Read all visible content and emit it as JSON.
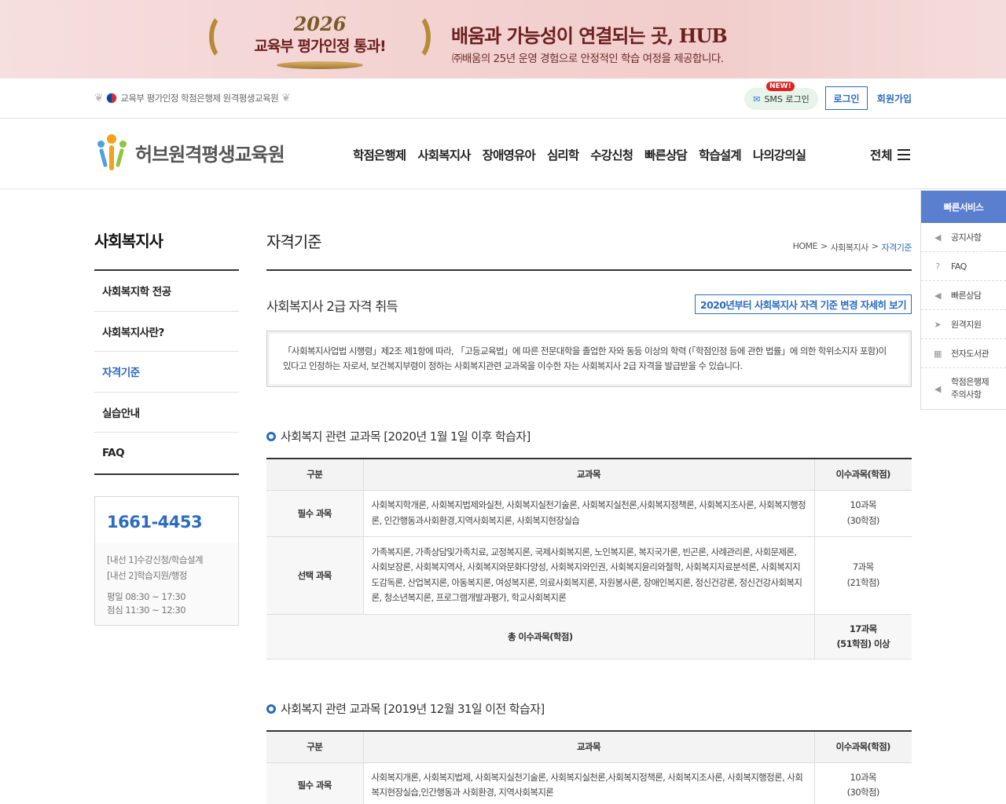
{
  "banner": {
    "year": "2026",
    "badge_text": "교육부 평가인정 통과!",
    "tagline": "배움과 가능성이 연결되는 곳, HUB",
    "subtitle": "㈜배움의 25년 운영 경험으로 안정적인 학습 여정을 제공합니다."
  },
  "util": {
    "cert_text": "교육부 평가인정 학점은행제 원격평생교육원",
    "sms_new": "NEW!",
    "sms_label": "SMS 로그인",
    "login": "로그인",
    "join": "회원가입"
  },
  "header": {
    "logo_name": "허브원격평생교육원",
    "gnb": [
      "학점은행제",
      "사회복지사",
      "장애영유아",
      "심리학",
      "수강신청",
      "빠른상담",
      "학습설계",
      "나의강의실"
    ],
    "all_menu": "전체"
  },
  "lnb": {
    "title": "사회복지사",
    "items": [
      {
        "label": "사회복지학 전공",
        "active": false
      },
      {
        "label": "사회복지사란?",
        "active": false
      },
      {
        "label": "자격기준",
        "active": true
      },
      {
        "label": "실습안내",
        "active": false
      },
      {
        "label": "FAQ",
        "active": false
      }
    ]
  },
  "cs": {
    "phone": "1661-4453",
    "line1": "[내선 1]수강신청/학습설계",
    "line2": "[내선 2]학습지원/행정",
    "hours1": "평일 08:30 ~ 17:30",
    "hours2": "점심 11:30 ~ 12:30"
  },
  "content": {
    "page_title": "자격기준",
    "breadcrumb": [
      "HOME",
      ">",
      "사회복지사",
      ">",
      "자격기준"
    ],
    "section_title": "사회복지사 2급 자격 취득",
    "more_button": "2020년부터 사회복지사 자격 기준 변경 자세히 보기",
    "notice_line1": "「사회복지사업법 시행령」제2조 제1항에 따라, 「고등교육법」에 따른 전문대학을 졸업한 자와 동등 이상의 학력 (「학점인정 등에 관한 법률」에 의한 학위소지자 포함)이",
    "notice_line2": "있다고 인정하는 자로서, 보건복지부령이 정하는 사회복지관련 교과목을 이수한 자는 사회복지사 2급 자격을 발급받을 수 있습니다."
  },
  "table1": {
    "heading": "사회복지 관련 교과목 [2020년 1월 1일 이후 학습자]",
    "headers": [
      "구분",
      "교과목",
      "이수과목(학점)"
    ],
    "rows": [
      {
        "type": "필수 과목",
        "subjects": "사회복지학개론, 사회복지법제와실천, 사회복지실천기술론, 사회복지실천론,사회복지정책론, 사회복지조사론, 사회복지행정론, 인간행동과사회환경,지역사회복지론, 사회복지현장실습",
        "credit1": "10과목",
        "credit2": "(30학점)"
      },
      {
        "type": "선택 과목",
        "subjects": "가족복지론, 가족상담및가족치료, 교정복지론, 국제사회복지론, 노인복지론, 복지국가론, 빈곤론, 사례관리론, 사회문제론, 사회보장론, 사회복지역사, 사회복지와문화다양성, 사회복지와인권, 사회복지윤리와철학, 사회복지자료분석론, 사회복지지도감독론, 산업복지론, 아동복지론, 여성복지론, 의료사회복지론, 자원봉사론, 장애인복지론, 정신건강론, 정신건강사회복지론, 청소년복지론, 프로그램개발과평가, 학교사회복지론",
        "credit1": "7과목",
        "credit2": "(21학점)"
      }
    ],
    "total_label": "총 이수과목(학점)",
    "total1": "17과목",
    "total2": "(51학점) 이상"
  },
  "table2": {
    "heading": "사회복지 관련 교과목 [2019년 12월 31일 이전 학습자]",
    "headers": [
      "구분",
      "교과목",
      "이수과목(학점)"
    ],
    "rows": [
      {
        "type": "필수 과목",
        "subjects": "사회복지개론, 사회복지법제, 사회복지실천기술론, 사회복지실천론,사회복지정책론, 사회복지조사론, 사회복지행정론, 사회복지현장실습,인간행동과 사회환경, 지역사회복지론",
        "credit1": "10과목",
        "credit2": "(30학점)"
      }
    ]
  },
  "quick": {
    "title": "빠른서비스",
    "items": [
      "공지사항",
      "FAQ",
      "빠른상담",
      "원격지원",
      "전자도서관",
      "학점은행제",
      "주의사항"
    ]
  },
  "colors": {
    "accent": "#2c6bbf",
    "quick_header": "#5b7fcf"
  }
}
